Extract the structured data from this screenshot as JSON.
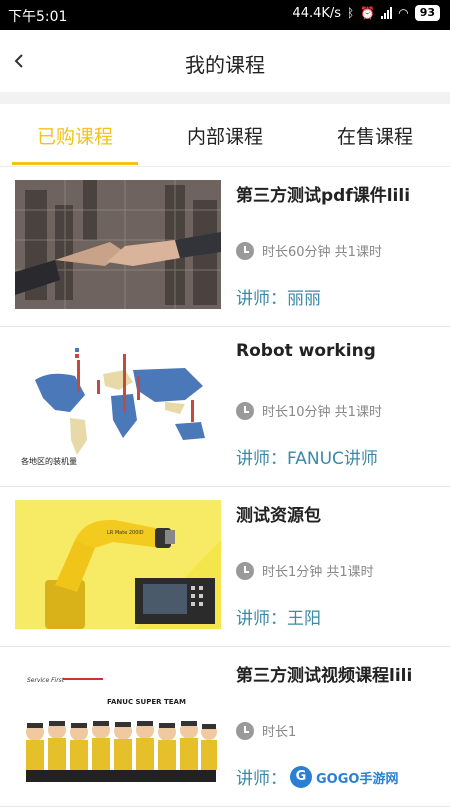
{
  "status_bar": {
    "time": "下午5:01",
    "speed": "44.4K/s",
    "battery": "93"
  },
  "header": {
    "title": "我的课程"
  },
  "tabs": [
    {
      "label": "已购课程",
      "active": true
    },
    {
      "label": "内部课程",
      "active": false
    },
    {
      "label": "在售课程",
      "active": false
    }
  ],
  "courses": [
    {
      "title": "第三方测试pdf课件lili",
      "meta": "时长60分钟 共1课时",
      "teacher": "讲师：丽丽"
    },
    {
      "title": "Robot working",
      "meta": "时长10分钟 共1课时",
      "teacher": "讲师：FANUC讲师"
    },
    {
      "title": "测试资源包",
      "meta": "时长1分钟 共1课时",
      "teacher": "讲师：王阳"
    },
    {
      "title": "第三方测试视频课程lili",
      "meta": "时长1",
      "teacher": "讲师："
    }
  ],
  "thumbs": {
    "map_caption": "各地区的装机量",
    "team_label": "FANUC SUPER TEAM",
    "service_label": "Service First",
    "robot_label": "LR Mate 200iD"
  },
  "watermark": {
    "text": "GOGO手游网"
  },
  "colors": {
    "accent": "#f2c31b",
    "teacher": "#3a8aa8",
    "meta": "#888888"
  }
}
